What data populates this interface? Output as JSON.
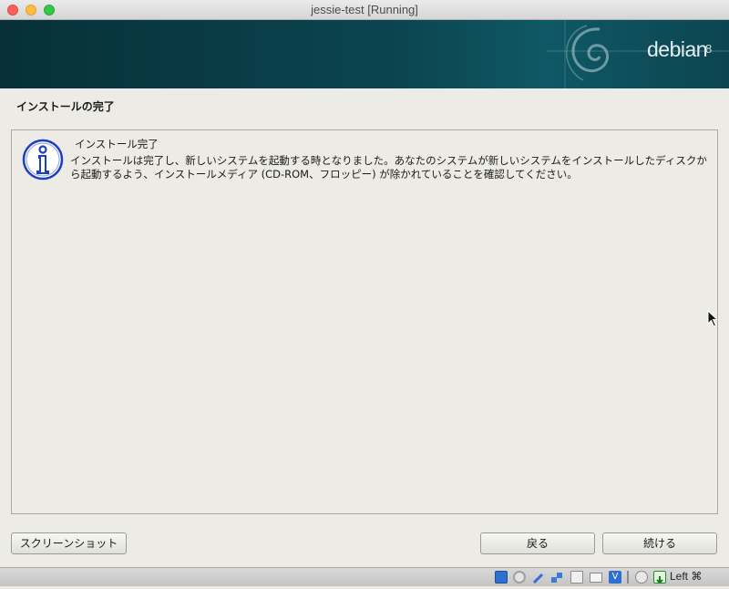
{
  "window": {
    "title": "jessie-test [Running]"
  },
  "banner": {
    "logo_text": "debian",
    "version": "8"
  },
  "page": {
    "title": "インストールの完了"
  },
  "message": {
    "heading": "インストール完了",
    "body": "インストールは完了し、新しいシステムを起動する時となりました。あなたのシステムが新しいシステムをインストールしたディスクから起動するよう、インストールメディア (CD-ROM、フロッピー) が除かれていることを確認してください。",
    "icon": "info-icon"
  },
  "buttons": {
    "screenshot": "スクリーンショット",
    "back": "戻る",
    "continue": "続ける"
  },
  "statusbar": {
    "icons": [
      "hard-disk-icon",
      "optical-drive-icon",
      "usb-icon",
      "network-icon",
      "shared-folder-icon",
      "display-icon",
      "video-capture-icon",
      "cpu-icon",
      "mouse-integration-icon",
      "keyboard-capture-icon"
    ],
    "host_key": "Left ⌘"
  },
  "colors": {
    "banner": "#0b4550",
    "panel_bg": "#ecebe6",
    "info_icon": "#1e3fc4"
  }
}
